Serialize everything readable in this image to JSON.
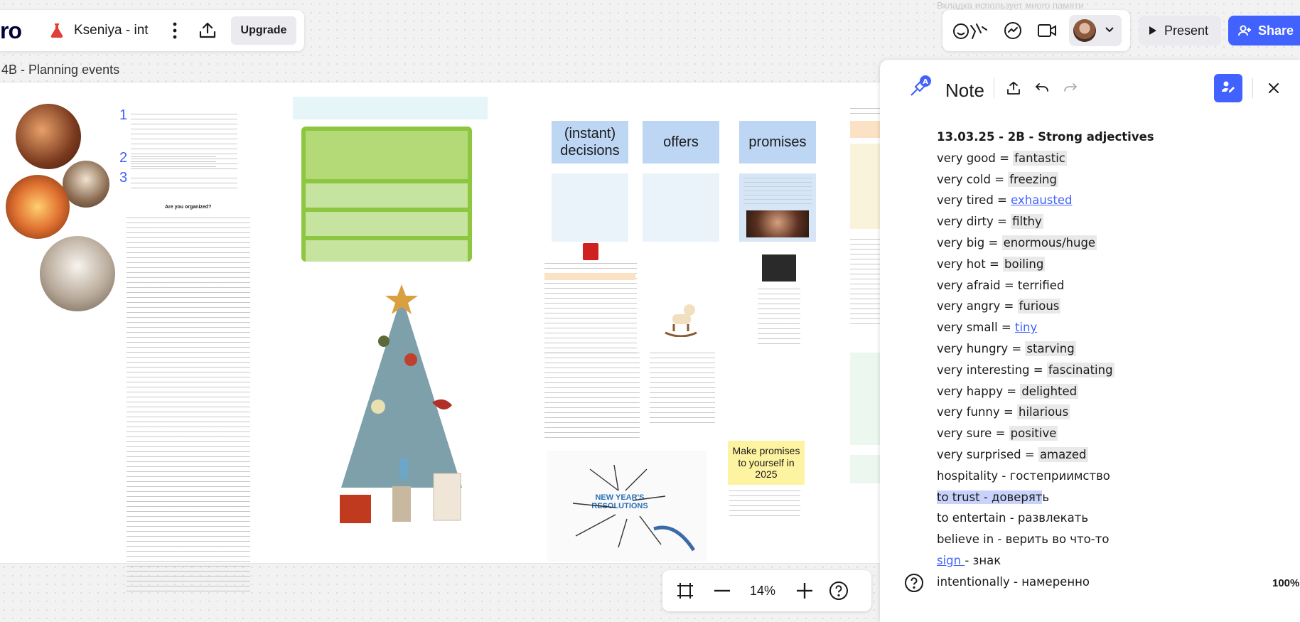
{
  "app": {
    "logo": "ro",
    "board_title": "Kseniya - int",
    "upgrade_label": "Upgrade"
  },
  "frame": {
    "label": "4B - Planning events"
  },
  "toolbar": {
    "present_label": "Present",
    "share_label": "Share",
    "faded_hint": "Вкладка использует много памяти"
  },
  "board": {
    "lesson_items": [
      "1",
      "2",
      "3"
    ],
    "lesson_heading": "Are you organized?",
    "column_headers": [
      "(instant)\ndecisions",
      "offers",
      "promises"
    ],
    "yellow_note": "Make promises to yourself in 2025",
    "resolutions_title": "NEW YEAR'S RESOLUTIONS"
  },
  "note": {
    "title": "Note",
    "lines": [
      {
        "text": "13.03.25 - 2B - Strong adjectives",
        "style": "title"
      },
      {
        "pre": "very good = ",
        "val": "fantastic",
        "style": "hl"
      },
      {
        "pre": "very cold = ",
        "val": "freezing",
        "style": "hl"
      },
      {
        "pre": "very tired = ",
        "val": "exhausted",
        "style": "link"
      },
      {
        "pre": "very dirty = ",
        "val": "filthy",
        "style": "hl"
      },
      {
        "pre": "very big = ",
        "val": "enormous/huge",
        "style": "hl"
      },
      {
        "pre": "very hot = ",
        "val": "boiling",
        "style": "hl"
      },
      {
        "pre": "very afraid = ",
        "val": "terrified",
        "style": "plain"
      },
      {
        "pre": "very angry = ",
        "val": "furious",
        "style": "hl"
      },
      {
        "pre": "very small = ",
        "val": "tiny",
        "style": "link"
      },
      {
        "pre": "very hungry = ",
        "val": "starving",
        "style": "hl"
      },
      {
        "pre": "very interesting = ",
        "val": "fascinating",
        "style": "hl"
      },
      {
        "pre": "very happy = ",
        "val": "delighted",
        "style": "hl"
      },
      {
        "pre": "very funny = ",
        "val": "hilarious",
        "style": "hl"
      },
      {
        "pre": "very sure = ",
        "val": "positive",
        "style": "hl"
      },
      {
        "pre": "very surprised = ",
        "val": "amazed",
        "style": "hl"
      },
      {
        "text": "hospitality - гостеприимство",
        "style": "plain"
      },
      {
        "sel": "to trust - доверят",
        "post": "ь",
        "style": "selected"
      },
      {
        "text": "to entertain - развлекать",
        "style": "plain"
      },
      {
        "text": "believe in - верить во что-то",
        "style": "plain"
      },
      {
        "pre": "",
        "val": "sign ",
        "post": "- знак",
        "style": "link-start"
      },
      {
        "text": "intentionally - намеренно",
        "style": "plain"
      }
    ],
    "zoom_percent": "100%"
  },
  "zoom": {
    "value": "14%"
  },
  "colors": {
    "accent": "#4262ff",
    "header_blue": "#bcd6f4",
    "note_yellow": "#fef3a0",
    "quiz_green": "#8dc63f"
  }
}
